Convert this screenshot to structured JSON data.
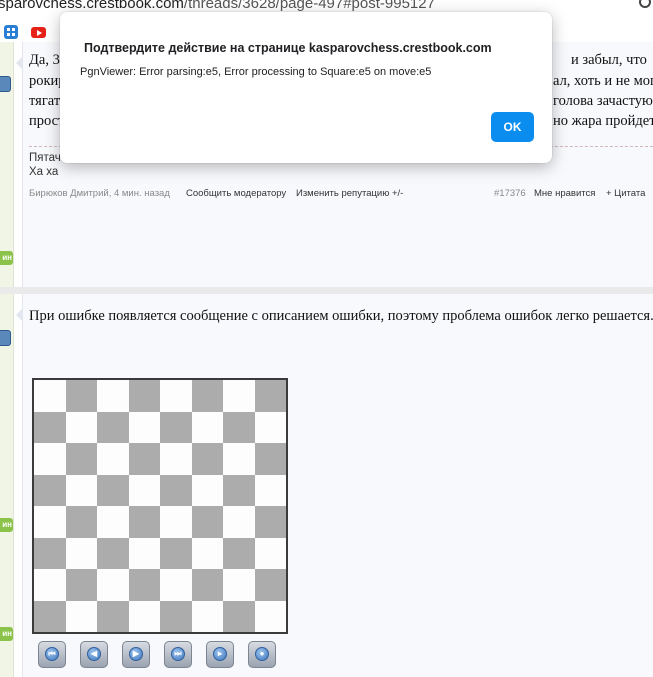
{
  "browser": {
    "url_host": "sparovchess.crestbook.com",
    "url_path": "/threads/3628/page-497#post-995127"
  },
  "post1": {
    "lines": [
      "Да, 3",
      "рокиру",
      "тягат",
      "прост"
    ],
    "right_fragments": [
      "и забыл, что",
      "ал, хоть и не мог",
      "голова зачастую",
      "но жара пройдет"
    ],
    "signature": [
      "Пятач",
      "Ха ха"
    ],
    "footer": {
      "author_time": "Бирюков Дмитрий, 4 мин. назад",
      "report": "Сообщить модератору",
      "reputation": "Изменить репутацию +/-",
      "post_no": "#17376",
      "like": "Мне нравится",
      "quote": "+ Цитата"
    }
  },
  "post2": {
    "text": "При ошибке появляется сообщение с описанием ошибки, поэтому проблема ошибок легко решается."
  },
  "badges": {
    "online": "ин"
  },
  "dialog": {
    "title": "Подтвердите действие на странице kasparovchess.crestbook.com",
    "message": "PgnViewer: Error parsing:e5, Error processing to Square:e5 on move:e5",
    "ok_label": "OK"
  },
  "viewer_controls": [
    {
      "name": "first-move-button",
      "icon": "skip-back-icon",
      "glyph": "⏮"
    },
    {
      "name": "prev-move-button",
      "icon": "step-back-icon",
      "glyph": "◀"
    },
    {
      "name": "next-move-button",
      "icon": "step-forward-icon",
      "glyph": "▶"
    },
    {
      "name": "last-move-button",
      "icon": "skip-forward-icon",
      "glyph": "⏭"
    },
    {
      "name": "play-button",
      "icon": "play-icon",
      "glyph": "▸"
    },
    {
      "name": "stop-button",
      "icon": "stop-icon",
      "glyph": "●"
    }
  ],
  "colors": {
    "ok_button": "#0b8df0",
    "dark_square": "#acacac",
    "light_square": "#fdfdfd"
  }
}
